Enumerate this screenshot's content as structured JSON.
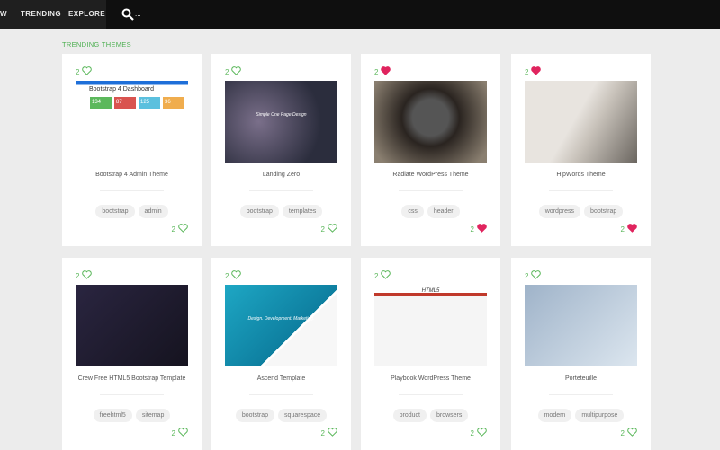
{
  "nav": {
    "items": [
      "W",
      "TRENDING",
      "EXPLORE"
    ],
    "search_text": "..."
  },
  "section_title": "TRENDING THEMES",
  "colors": {
    "liked": "#e0245e",
    "unliked": "#5cb85c",
    "accent": "#4caf50"
  },
  "cards": [
    {
      "title": "Bootstrap 4 Admin Theme",
      "likes": "2",
      "liked": false,
      "tags": [
        "bootstrap",
        "admin"
      ],
      "thumb_caption": "Bootstrap 4 Dashboard",
      "thumb_stats": [
        "134",
        "87",
        "125",
        "36"
      ]
    },
    {
      "title": "Landing Zero",
      "likes": "2",
      "liked": false,
      "tags": [
        "bootstrap",
        "templates"
      ],
      "thumb_caption": "Simple One Page Design"
    },
    {
      "title": "Radiate WordPress Theme",
      "likes": "2",
      "liked": true,
      "tags": [
        "css",
        "header"
      ]
    },
    {
      "title": "HipWords Theme",
      "likes": "2",
      "liked": true,
      "tags": [
        "wordpress",
        "bootstrap"
      ]
    },
    {
      "title": "Crew Free HTML5 Bootstrap Template",
      "likes": "2",
      "liked": false,
      "tags": [
        "freehtml5",
        "sitemap"
      ]
    },
    {
      "title": "Ascend Template",
      "likes": "2",
      "liked": false,
      "tags": [
        "bootstrap",
        "squarespace"
      ],
      "thumb_caption": "Design. Development. Marketing."
    },
    {
      "title": "Playbook WordPress Theme",
      "likes": "2",
      "liked": false,
      "tags": [
        "product",
        "browsers"
      ],
      "thumb_caption": "HTML5"
    },
    {
      "title": "Porteteuille",
      "likes": "2",
      "liked": false,
      "tags": [
        "modern",
        "multipurpose"
      ]
    }
  ]
}
